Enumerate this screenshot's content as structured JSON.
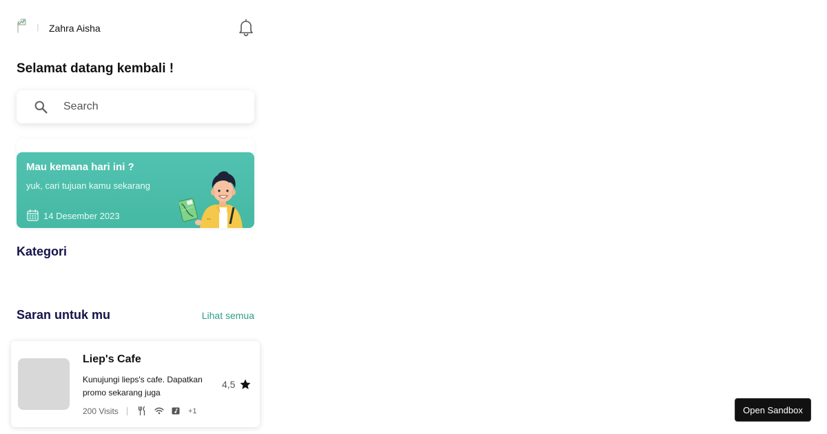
{
  "header": {
    "user_name": "Zahra Aisha",
    "avatar_icon": "broken-image-icon",
    "notification_icon": "bell-icon"
  },
  "welcome": "Selamat datang kembali !",
  "search": {
    "placeholder": "Search",
    "value": "",
    "icon": "search-icon"
  },
  "banner": {
    "title": "Mau kemana hari ini ?",
    "subtitle": "yuk, cari tujuan kamu sekarang",
    "date": "14 Desember 2023",
    "date_icon": "calendar-icon",
    "color": "#4ebfac"
  },
  "categories": {
    "title": "Kategori"
  },
  "suggestions": {
    "title": "Saran untuk mu",
    "see_all": "Lihat semua",
    "items": [
      {
        "name": "Liep's Cafe",
        "description": "Kunujungi lieps's cafe. Dapatkan promo sekarang juga",
        "rating": "4,5",
        "visits": "200 Visits",
        "facilities": [
          "utensils-icon",
          "wifi-icon",
          "music-icon"
        ],
        "more_facilities": "+1"
      }
    ]
  },
  "sandbox": {
    "label": "Open Sandbox"
  },
  "colors": {
    "accent": "#2e9d8a",
    "heading": "#14134a",
    "banner": "#4ebfac"
  }
}
